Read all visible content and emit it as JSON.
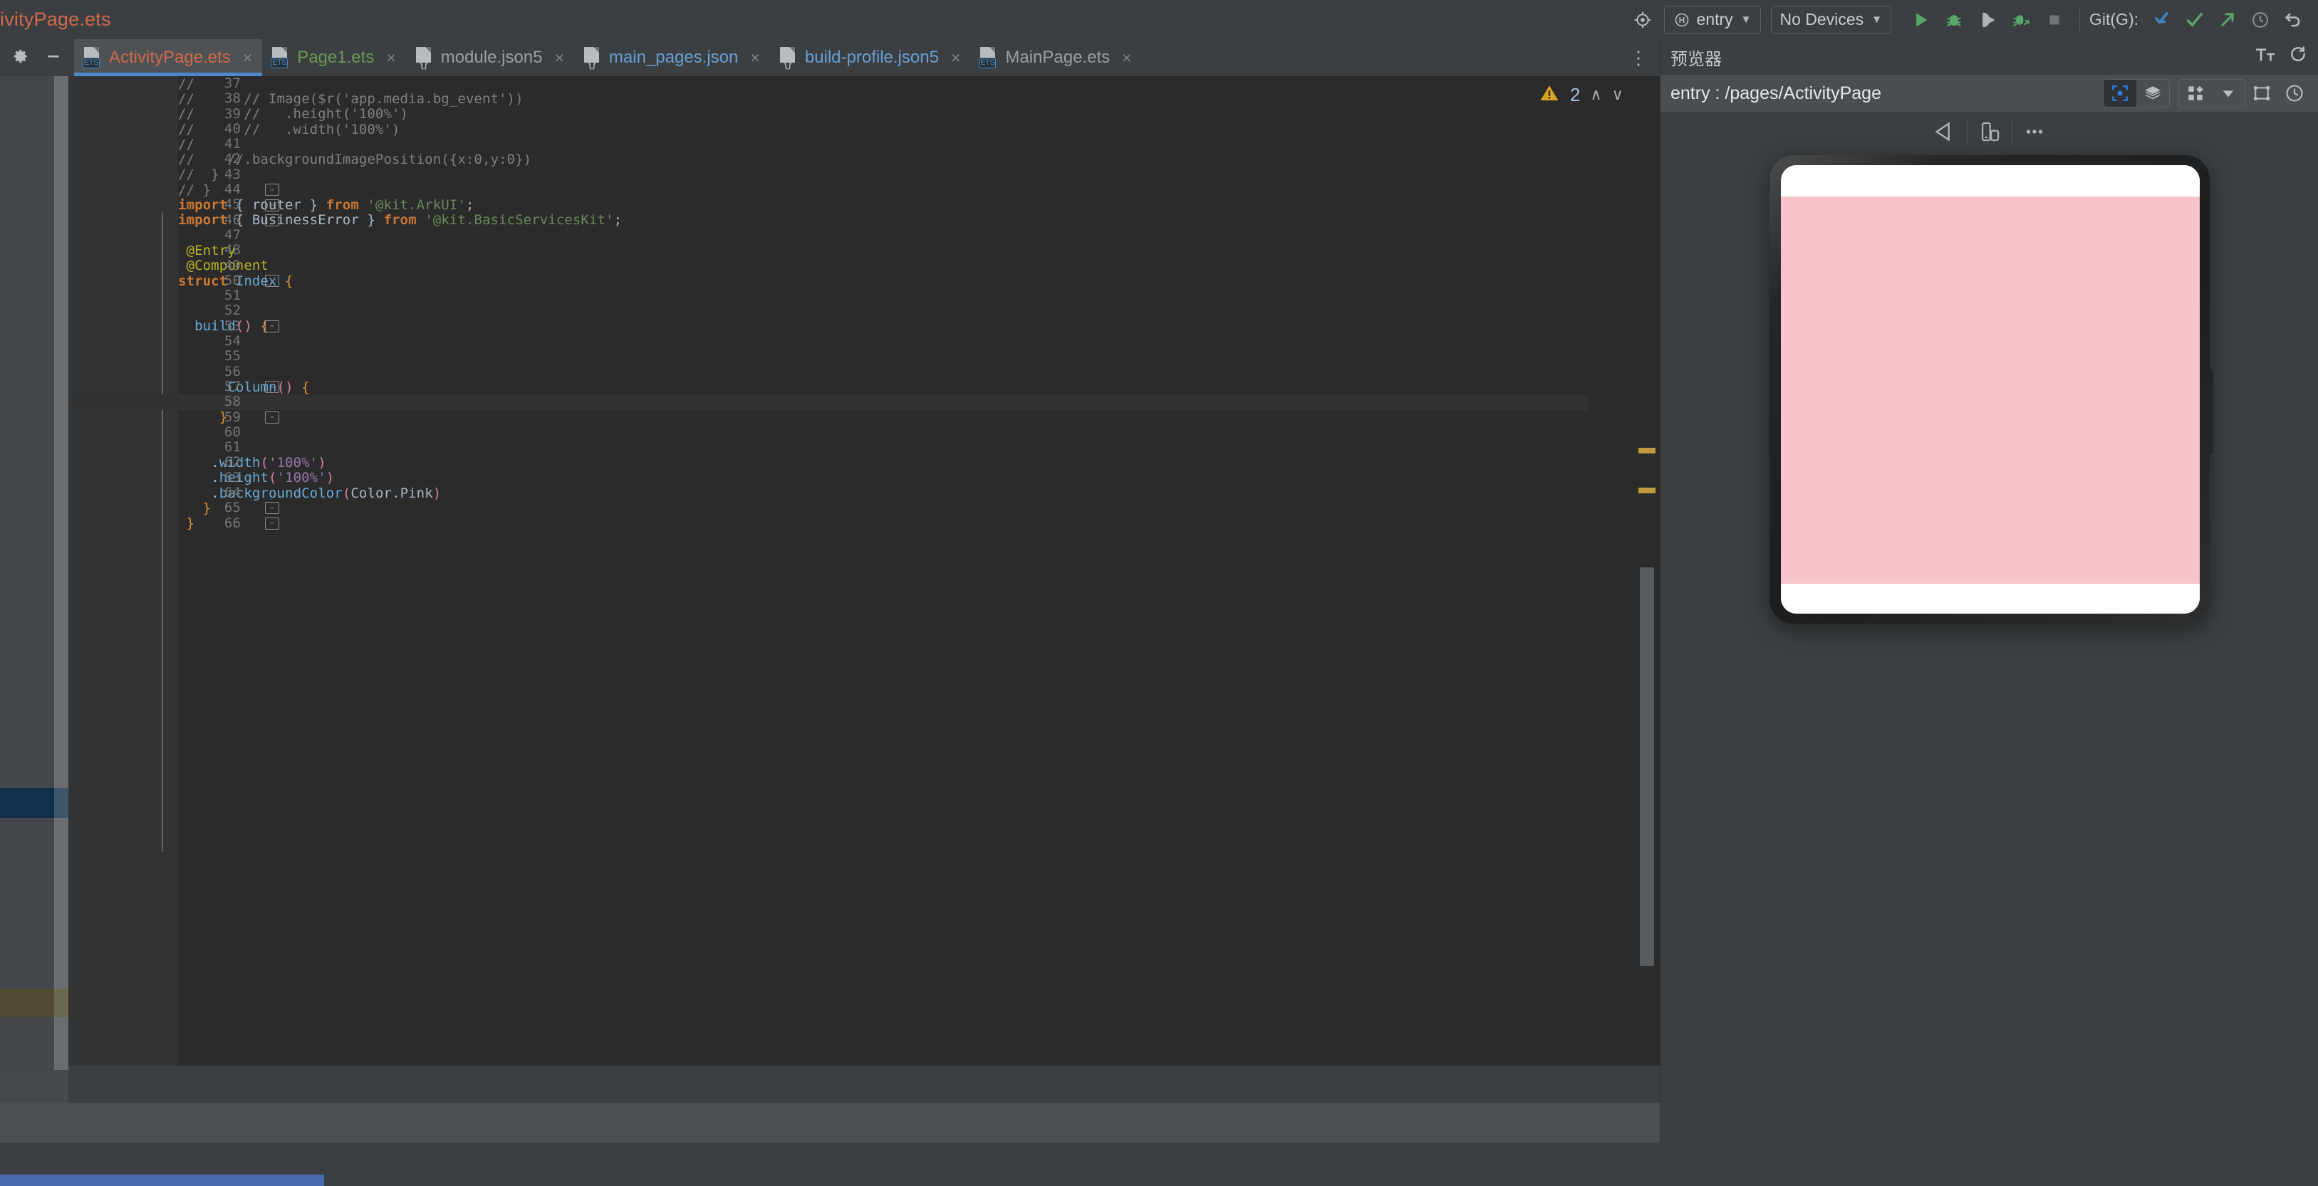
{
  "window": {
    "title": "ivityPage.ets"
  },
  "toolbar": {
    "target_icon": "target-icon",
    "module": {
      "label": "entry",
      "icon": "harmony-module-icon",
      "caret": "▼"
    },
    "device": {
      "label": "No Devices",
      "caret": "▼"
    },
    "run": "run-icon",
    "debug": "debug-icon",
    "run_coverage": "run-coverage-icon",
    "attach_debugger": "attach-debugger-icon",
    "stop": "stop-icon",
    "git_label": "Git(G):",
    "git_update": "git-update-icon",
    "git_commit": "git-commit-icon",
    "git_push": "git-push-icon",
    "git_history": "git-history-icon",
    "git_rollback": "git-rollback-icon"
  },
  "tabbar": {
    "settings_icon": "gear-icon",
    "minimize_icon": "minimize-icon",
    "more_icon": "⋮",
    "tabs": [
      {
        "label": "ActivityPage.ets",
        "kind": "ets",
        "badge": "ETS",
        "color": "#cf6a4c",
        "active": true,
        "close": "×"
      },
      {
        "label": "Page1.ets",
        "kind": "ets",
        "badge": "ETS",
        "color": "#6a9955",
        "active": false,
        "close": "×"
      },
      {
        "label": "module.json5",
        "kind": "json",
        "badge": "{}",
        "color": "#9aa0a6",
        "active": false,
        "close": "×"
      },
      {
        "label": "main_pages.json",
        "kind": "json",
        "badge": "{}",
        "color": "#6a9fd4",
        "active": false,
        "close": "×"
      },
      {
        "label": "build-profile.json5",
        "kind": "json",
        "badge": "{}",
        "color": "#6a9fd4",
        "active": false,
        "close": "×"
      },
      {
        "label": "MainPage.ets",
        "kind": "ets",
        "badge": "ETS",
        "color": "#9aa0a6",
        "active": false,
        "close": "×"
      }
    ]
  },
  "inspections": {
    "warning_icon": "warning-triangle-icon",
    "count": "2",
    "prev_icon": "∧",
    "next_icon": "∨"
  },
  "editor": {
    "first_line": 37,
    "lines": [
      {
        "n": 37,
        "fold": "",
        "tokens": [
          {
            "t": "//",
            "c": "c-comment"
          }
        ],
        "indent": 0
      },
      {
        "n": 38,
        "fold": "",
        "tokens": [
          {
            "t": "//      // Image($r('app.media.bg_event'))",
            "c": "c-comment"
          }
        ],
        "indent": 0
      },
      {
        "n": 39,
        "fold": "",
        "tokens": [
          {
            "t": "//      //   .height('100%')",
            "c": "c-comment"
          }
        ],
        "indent": 0
      },
      {
        "n": 40,
        "fold": "",
        "tokens": [
          {
            "t": "//      //   .width('100%')",
            "c": "c-comment"
          }
        ],
        "indent": 0
      },
      {
        "n": 41,
        "fold": "",
        "tokens": [
          {
            "t": "//",
            "c": "c-comment"
          }
        ],
        "indent": 0
      },
      {
        "n": 42,
        "fold": "",
        "tokens": [
          {
            "t": "//    //.backgroundImagePosition({x:0,y:0})",
            "c": "c-comment"
          }
        ],
        "indent": 0
      },
      {
        "n": 43,
        "fold": "",
        "tokens": [
          {
            "t": "//  }",
            "c": "c-comment"
          }
        ],
        "indent": 0
      },
      {
        "n": 44,
        "fold": "-",
        "tokens": [
          {
            "t": "// }",
            "c": "c-comment"
          }
        ],
        "indent": 0
      },
      {
        "n": 45,
        "fold": "-",
        "tokens": [
          {
            "t": "import",
            "c": "c-kw"
          },
          {
            "t": " { router } ",
            "c": "c-plain"
          },
          {
            "t": "from",
            "c": "c-kw"
          },
          {
            "t": " ",
            "c": "c-plain"
          },
          {
            "t": "'@kit.ArkUI'",
            "c": "c-str"
          },
          {
            "t": ";",
            "c": "c-plain"
          }
        ],
        "indent": 0
      },
      {
        "n": 46,
        "fold": "-",
        "tokens": [
          {
            "t": "import",
            "c": "c-kw"
          },
          {
            "t": " { BusinessError } ",
            "c": "c-plain"
          },
          {
            "t": "from",
            "c": "c-kw"
          },
          {
            "t": " ",
            "c": "c-plain"
          },
          {
            "t": "'@kit.BasicServicesKit'",
            "c": "c-str"
          },
          {
            "t": ";",
            "c": "c-plain"
          }
        ],
        "indent": 0
      },
      {
        "n": 47,
        "fold": "",
        "tokens": [],
        "indent": 0
      },
      {
        "n": 48,
        "fold": "",
        "tokens": [
          {
            "t": "@Entry",
            "c": "c-dec"
          }
        ],
        "indent": 1
      },
      {
        "n": 49,
        "fold": "",
        "tokens": [
          {
            "t": "@Component",
            "c": "c-dec"
          }
        ],
        "indent": 1
      },
      {
        "n": 50,
        "fold": "-",
        "tokens": [
          {
            "t": "struct",
            "c": "c-kw"
          },
          {
            "t": " ",
            "c": "c-plain"
          },
          {
            "t": "Index",
            "c": "c-type"
          },
          {
            "t": " ",
            "c": "c-plain"
          },
          {
            "t": "{",
            "c": "c-brace"
          }
        ],
        "indent": 0
      },
      {
        "n": 51,
        "fold": "",
        "tokens": [],
        "indent": 0
      },
      {
        "n": 52,
        "fold": "",
        "tokens": [],
        "indent": 0
      },
      {
        "n": 53,
        "fold": "-",
        "tokens": [
          {
            "t": "build",
            "c": "c-fn"
          },
          {
            "t": "()",
            "c": "c-paren"
          },
          {
            "t": " ",
            "c": "c-plain"
          },
          {
            "t": "{",
            "c": "c-brace"
          }
        ],
        "indent": 2
      },
      {
        "n": 54,
        "fold": "",
        "tokens": [],
        "indent": 0
      },
      {
        "n": 55,
        "fold": "",
        "tokens": [],
        "indent": 0
      },
      {
        "n": 56,
        "fold": "",
        "tokens": [],
        "indent": 0
      },
      {
        "n": 57,
        "fold": "-",
        "tokens": [
          {
            "t": "Column",
            "c": "c-type"
          },
          {
            "t": "()",
            "c": "c-paren"
          },
          {
            "t": " ",
            "c": "c-plain"
          },
          {
            "t": "{",
            "c": "c-brace"
          }
        ],
        "indent": 6
      },
      {
        "n": 58,
        "fold": "",
        "tokens": [],
        "indent": 0
      },
      {
        "n": 59,
        "fold": "-",
        "tokens": [
          {
            "t": "}",
            "c": "c-brace"
          }
        ],
        "indent": 5
      },
      {
        "n": 60,
        "fold": "",
        "tokens": [],
        "indent": 0
      },
      {
        "n": 61,
        "fold": "",
        "tokens": [],
        "indent": 0
      },
      {
        "n": 62,
        "fold": "",
        "tokens": [
          {
            "t": ".",
            "c": "c-plain"
          },
          {
            "t": "width",
            "c": "c-fn"
          },
          {
            "t": "(",
            "c": "c-paren"
          },
          {
            "t": "'100%'",
            "c": "c-pstr"
          },
          {
            "t": ")",
            "c": "c-paren"
          }
        ],
        "indent": 4
      },
      {
        "n": 63,
        "fold": "",
        "tokens": [
          {
            "t": ".",
            "c": "c-plain"
          },
          {
            "t": "height",
            "c": "c-fn"
          },
          {
            "t": "(",
            "c": "c-paren"
          },
          {
            "t": "'100%'",
            "c": "c-pstr"
          },
          {
            "t": ")",
            "c": "c-paren"
          }
        ],
        "indent": 4
      },
      {
        "n": 64,
        "fold": "",
        "tokens": [
          {
            "t": ".",
            "c": "c-plain"
          },
          {
            "t": "backgroundColor",
            "c": "c-fn"
          },
          {
            "t": "(",
            "c": "c-paren"
          },
          {
            "t": "Color.Pink",
            "c": "c-ident"
          },
          {
            "t": ")",
            "c": "c-paren"
          }
        ],
        "indent": 4
      },
      {
        "n": 65,
        "fold": "-",
        "tokens": [
          {
            "t": "}",
            "c": "c-brace"
          }
        ],
        "indent": 3
      },
      {
        "n": 66,
        "fold": "-",
        "tokens": [
          {
            "t": "}",
            "c": "c-brace"
          }
        ],
        "indent": 1
      }
    ],
    "highlight_line": 58
  },
  "preview": {
    "title": "预览器",
    "font_size_icon": "font-size-icon",
    "refresh_icon": "refresh-icon",
    "path": "entry : /pages/ActivityPage",
    "inspect_icon": "inspect-target-icon",
    "layers_icon": "layers-icon",
    "grid_icon": "component-grid-icon",
    "grid_caret": "▼",
    "bounds_icon": "show-bounds-icon",
    "clock_icon": "clock-icon",
    "back_icon": "back-triangle-icon",
    "rotate_icon": "rotate-device-icon",
    "more_icon": "more-dots-icon",
    "device": {
      "screen_background": "#f7c3cd",
      "statusbar_background": "#ffffff",
      "navbar_background": "#ffffff"
    }
  },
  "colors": {
    "accent_blue": "#4a88c7",
    "warning_yellow": "#bd9b3c",
    "pink": "#f7c3cd",
    "editor_bg": "#2b2b2b",
    "panel_bg": "#3c3f41"
  }
}
